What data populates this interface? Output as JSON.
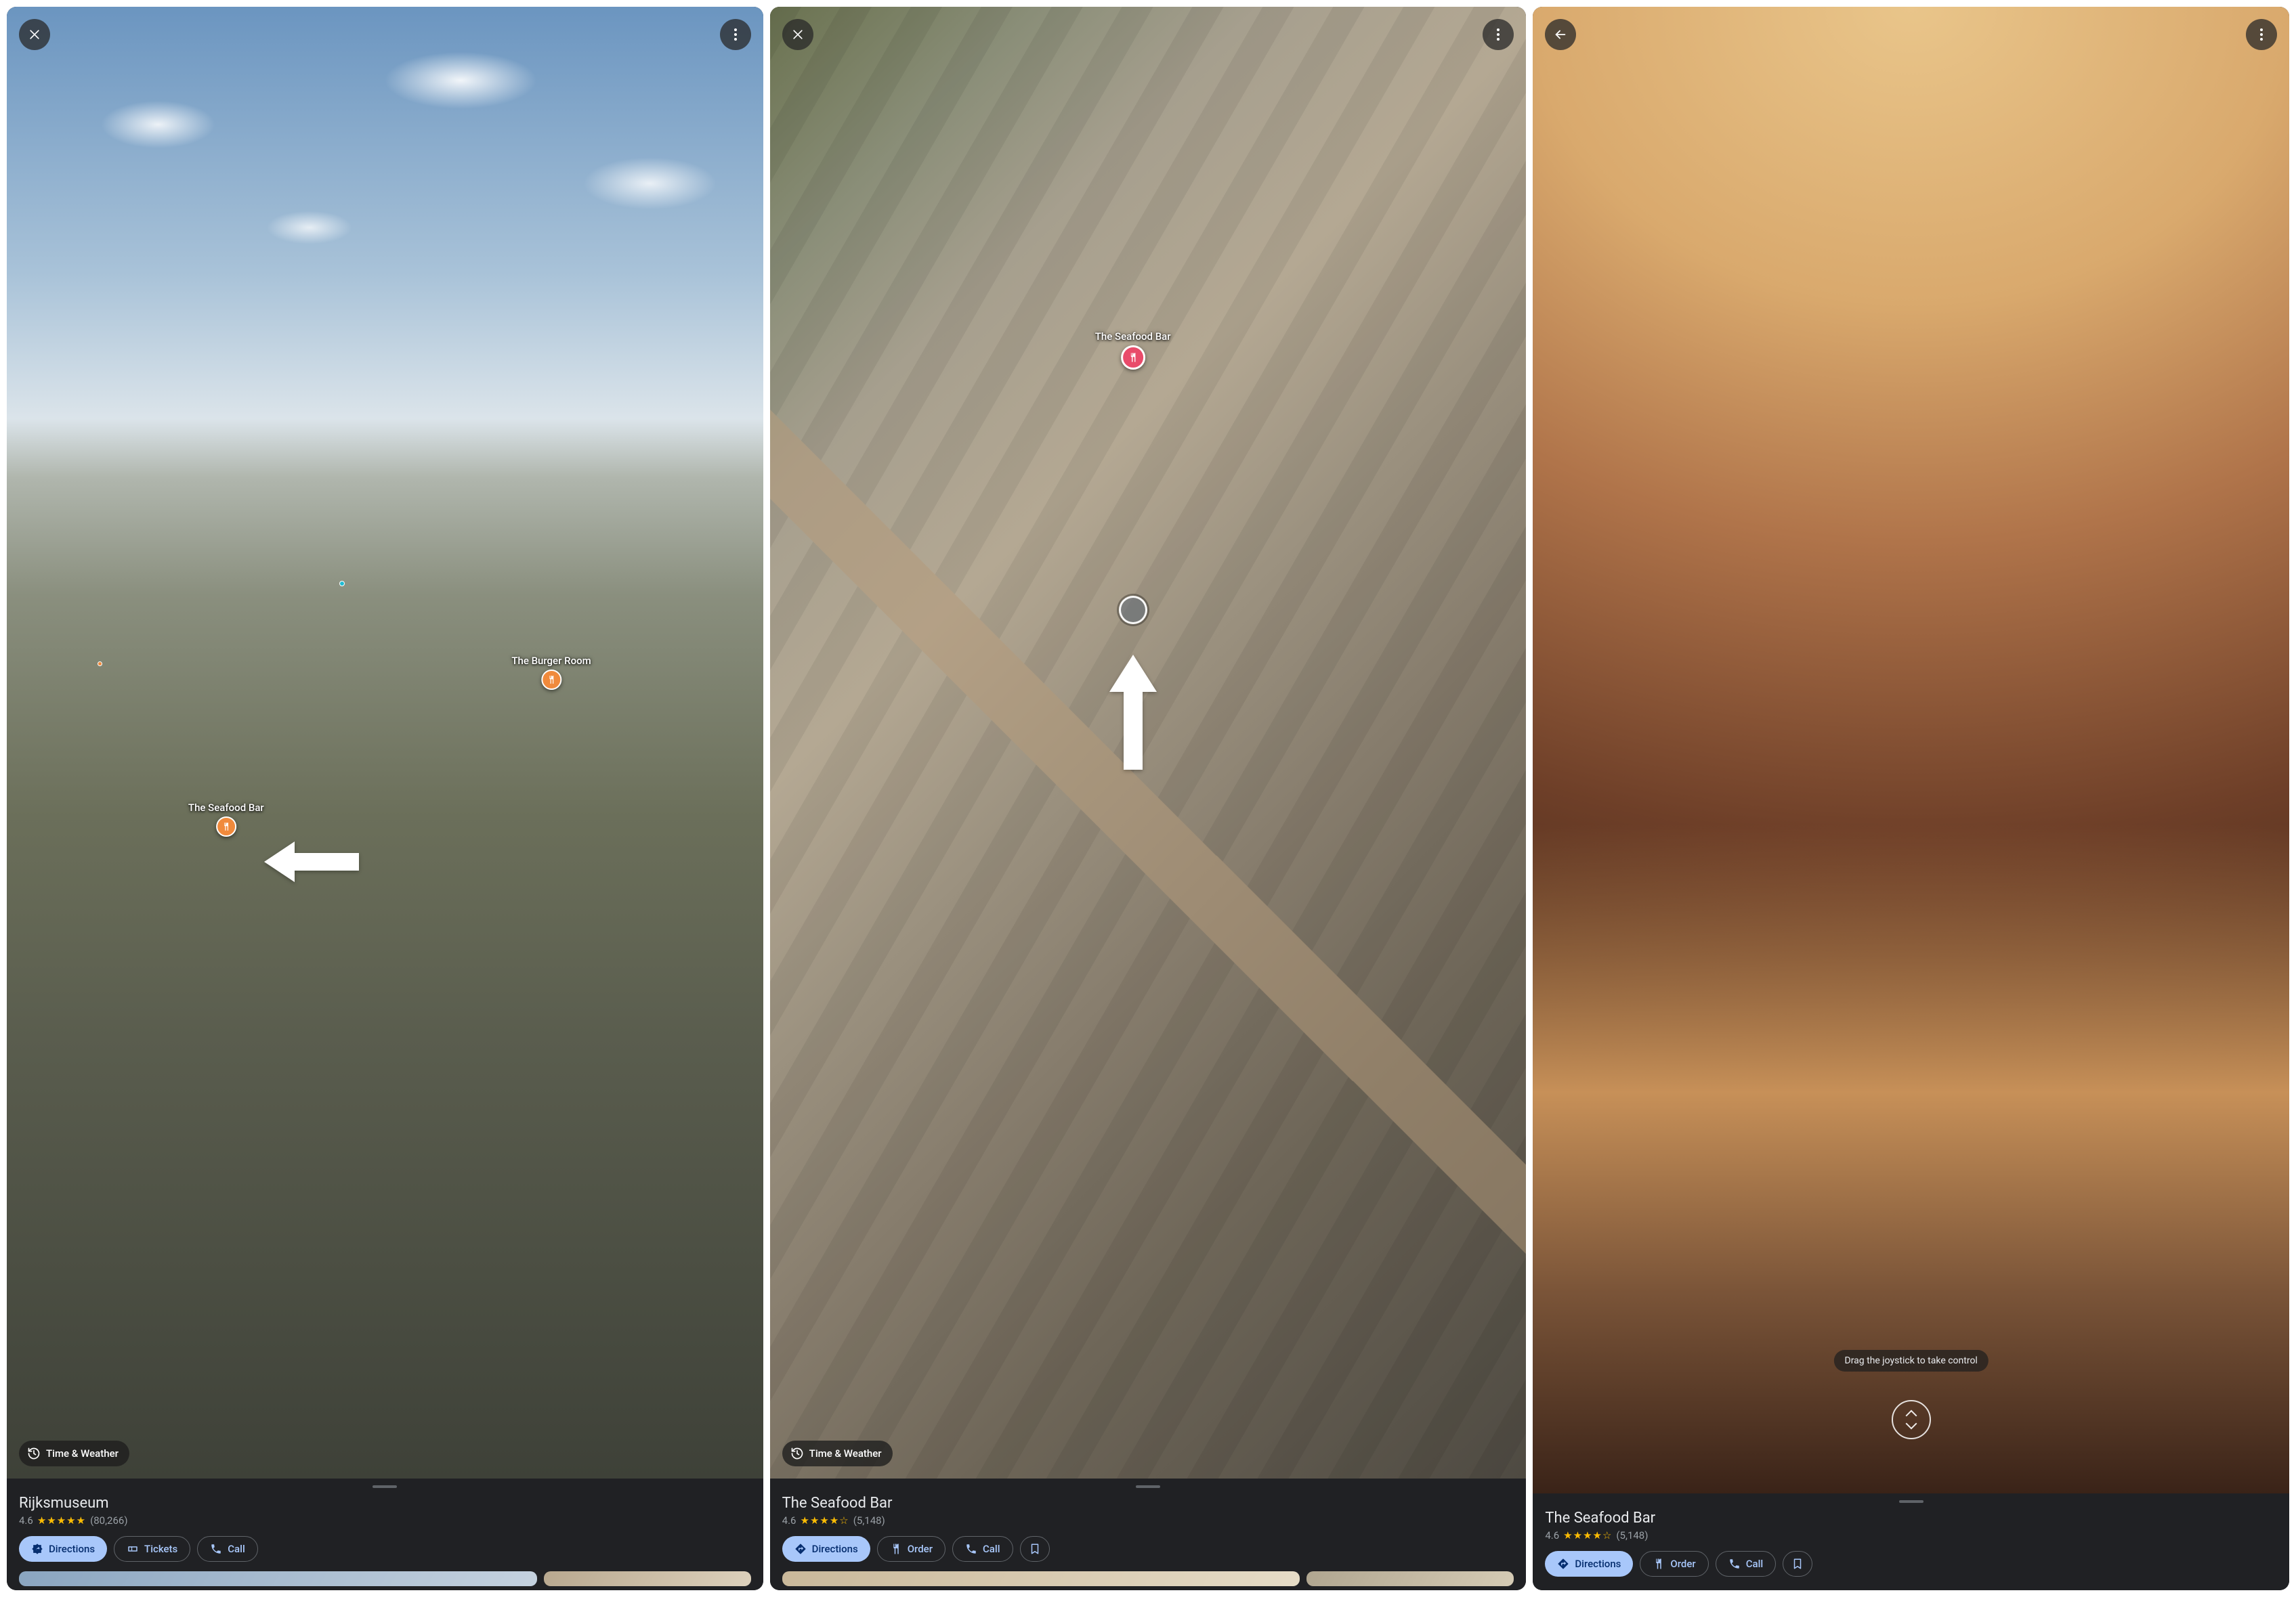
{
  "panels": [
    {
      "top_left_icon": "close",
      "map_labels": {
        "burger_room": "The Burger Room",
        "seafood_bar": "The Seafood Bar"
      },
      "time_weather_label": "Time & Weather",
      "sheet": {
        "title": "Rijksmuseum",
        "rating_value": "4.6",
        "stars": "★★★★★",
        "review_count": "(80,266)",
        "actions": [
          {
            "key": "directions",
            "label": "Directions",
            "icon": "directions",
            "style": "primary"
          },
          {
            "key": "tickets",
            "label": "Tickets",
            "icon": "ticket",
            "style": "outline"
          },
          {
            "key": "call",
            "label": "Call",
            "icon": "phone",
            "style": "outline"
          }
        ]
      }
    },
    {
      "top_left_icon": "close",
      "map_labels": {
        "seafood_bar": "The Seafood Bar"
      },
      "time_weather_label": "Time & Weather",
      "sheet": {
        "title": "The Seafood Bar",
        "rating_value": "4.6",
        "stars": "★★★★☆",
        "review_count": "(5,148)",
        "actions": [
          {
            "key": "directions",
            "label": "Directions",
            "icon": "directions",
            "style": "primary"
          },
          {
            "key": "order",
            "label": "Order",
            "icon": "fork",
            "style": "outline"
          },
          {
            "key": "call",
            "label": "Call",
            "icon": "phone",
            "style": "outline"
          },
          {
            "key": "save",
            "label": "",
            "icon": "bookmark",
            "style": "outline"
          }
        ]
      }
    },
    {
      "top_left_icon": "back",
      "joystick_hint": "Drag the joystick to take control",
      "sheet": {
        "title": "The Seafood Bar",
        "rating_value": "4.6",
        "stars": "★★★★☆",
        "review_count": "(5,148)",
        "actions": [
          {
            "key": "directions",
            "label": "Directions",
            "icon": "directions",
            "style": "primary"
          },
          {
            "key": "order",
            "label": "Order",
            "icon": "fork",
            "style": "outline"
          },
          {
            "key": "call",
            "label": "Call",
            "icon": "phone",
            "style": "outline"
          },
          {
            "key": "save",
            "label": "",
            "icon": "bookmark",
            "style": "outline"
          }
        ]
      }
    }
  ]
}
